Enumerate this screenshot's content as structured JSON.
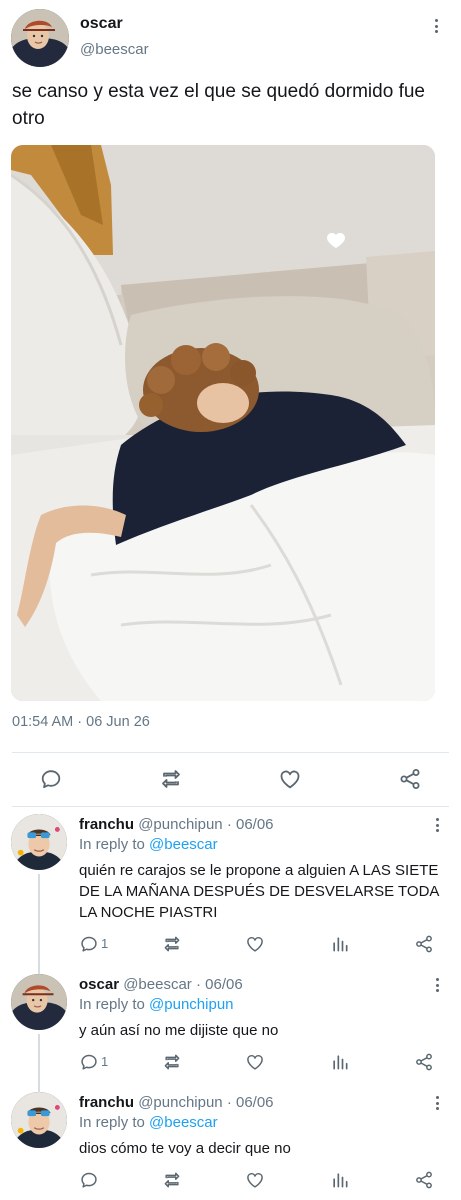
{
  "tweet": {
    "author_name": "oscar",
    "author_handle": "@beescar",
    "text": "se canso y esta vez el que se quedó dormido fue otro",
    "timestamp": "01:54 AM · 06 Jun 26",
    "photo": "photo of a person with curly hair asleep face-down on a bed under white sheets, heart sticker on wall",
    "actions": [
      "reply-icon",
      "retweet-icon",
      "like-icon",
      "share-icon"
    ]
  },
  "replies": [
    {
      "name": "franchu",
      "handle": "@punchipun",
      "date": "· 06/06",
      "in_reply_label": "In reply to",
      "in_reply_to": "@beescar",
      "text": "quién re carajos se le propone a alguien A LAS SIETE DE LA MAÑANA DESPUÉS DE DESVELARSE TODA LA NOCHE PIASTRI",
      "reply_count": "1"
    },
    {
      "name": "oscar",
      "handle": "@beescar",
      "date": "· 06/06",
      "in_reply_label": "In reply to",
      "in_reply_to": "@punchipun",
      "text": "y aún así no me dijiste que no",
      "reply_count": "1"
    },
    {
      "name": "franchu",
      "handle": "@punchipun",
      "date": "· 06/06",
      "in_reply_label": "In reply to",
      "in_reply_to": "@beescar",
      "text": "dios cómo te voy a decir que no",
      "reply_count": ""
    }
  ],
  "colors": {
    "text": "#14171a",
    "secondary": "#657786",
    "link": "#1da1f2",
    "divider": "#e1e8ed",
    "icon": "#5b6770"
  }
}
